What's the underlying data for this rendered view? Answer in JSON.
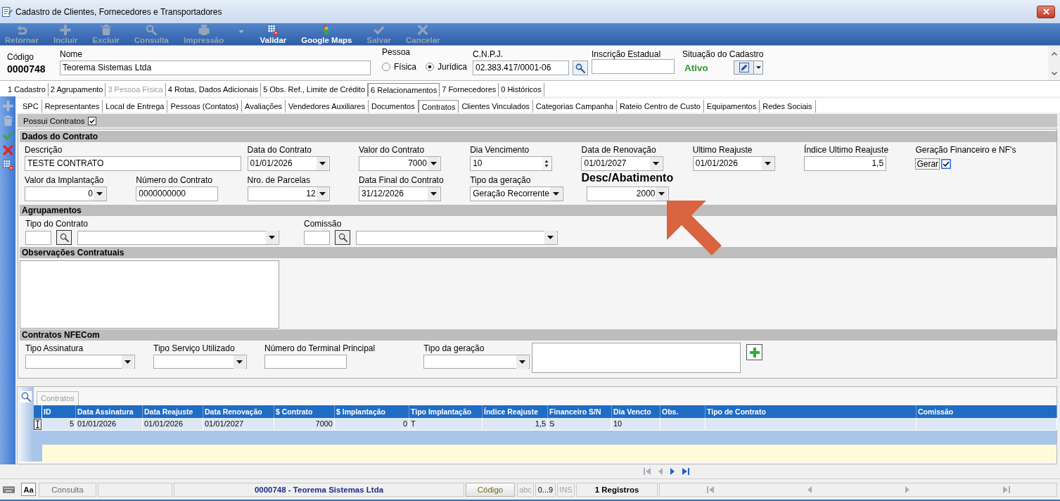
{
  "window": {
    "title": "Cadastro de Clientes, Fornecedores e Transportadores"
  },
  "toolbar": [
    {
      "label": "Retornar",
      "disabled": true,
      "menu": false
    },
    {
      "label": "Incluir",
      "disabled": true,
      "menu": false
    },
    {
      "label": "Excluir",
      "disabled": true,
      "menu": false
    },
    {
      "label": "Consulta",
      "disabled": true,
      "menu": false
    },
    {
      "label": "Impressão",
      "disabled": true,
      "menu": true
    },
    {
      "label": "Validar",
      "disabled": false,
      "menu": false
    },
    {
      "label": "Google Maps",
      "disabled": false,
      "menu": false
    },
    {
      "label": "Salvar",
      "disabled": true,
      "menu": false
    },
    {
      "label": "Cancelar",
      "disabled": true,
      "menu": false
    }
  ],
  "record": {
    "code_label": "Código",
    "code": "0000748",
    "name_label": "Nome",
    "name": "Teorema Sistemas Ltda",
    "person_label": "Pessoa",
    "person_types": [
      {
        "label": "Física",
        "selected": false
      },
      {
        "label": "Jurídica",
        "selected": true
      }
    ],
    "cnpj_label": "C.N.P.J.",
    "cnpj": "02.383.417/0001-06",
    "state_registration_label": "Inscrição Estadual",
    "status_label": "Situação do Cadastro",
    "status": "Ativo"
  },
  "tabs": [
    {
      "label": "1 Cadastro",
      "selected": false,
      "disabled": false
    },
    {
      "label": "2 Agrupamento",
      "selected": false,
      "disabled": false
    },
    {
      "label": "3 Pessoa Física",
      "selected": false,
      "disabled": true
    },
    {
      "label": "4 Rotas, Dados Adicionais",
      "selected": false,
      "disabled": false
    },
    {
      "label": "5 Obs. Ref., Limite de Crédito",
      "selected": false,
      "disabled": false
    },
    {
      "label": "6 Relacionamentos",
      "selected": true,
      "disabled": false
    },
    {
      "label": "7 Fornecedores",
      "selected": false,
      "disabled": false
    },
    {
      "label": "0 Históricos",
      "selected": false,
      "disabled": false
    }
  ],
  "side_tools": [
    {
      "disabled": true
    },
    {
      "disabled": true
    },
    {
      "disabled": false
    },
    {
      "disabled": false
    },
    {
      "disabled": false
    }
  ],
  "subtabs": [
    {
      "label": "SPC",
      "selected": false
    },
    {
      "label": "Representantes",
      "selected": false
    },
    {
      "label": "Local de Entrega",
      "selected": false
    },
    {
      "label": "Pessoas (Contatos)",
      "selected": false
    },
    {
      "label": "Avaliações",
      "selected": false
    },
    {
      "label": "Vendedores Auxiliares",
      "selected": false
    },
    {
      "label": "Documentos",
      "selected": false
    },
    {
      "label": "Contratos",
      "selected": true
    },
    {
      "label": "Clientes Vinculados",
      "selected": false
    },
    {
      "label": "Categorias Campanha",
      "selected": false
    },
    {
      "label": "Rateio Centro de Custo",
      "selected": false
    },
    {
      "label": "Equipamentos",
      "selected": false
    },
    {
      "label": "Redes Sociais",
      "selected": false
    }
  ],
  "contracts_flag": {
    "label": "Possui Contratos",
    "checked": true
  },
  "contract_data": {
    "title": "Dados do Contrato",
    "fields": [
      {
        "kind": "text",
        "label": "Descrição",
        "value": "TESTE CONTRATO",
        "emphasized": false
      },
      {
        "kind": "combo",
        "label": "Data do Contrato",
        "value": "01/01/2026",
        "emphasized": false
      },
      {
        "kind": "amount",
        "label": "Valor do Contrato",
        "value": "7000",
        "emphasized": false
      },
      {
        "kind": "spin",
        "label": "Dia Vencimento",
        "value": "10",
        "emphasized": false
      },
      {
        "kind": "combo",
        "label": "Data de Renovação",
        "value": "01/01/2027",
        "emphasized": false
      },
      {
        "kind": "combo",
        "label": "Ultimo Reajuste",
        "value": "01/01/2026",
        "emphasized": false
      },
      {
        "kind": "number",
        "label": "Índice Ultimo Reajuste",
        "value": "1,5",
        "emphasized": false
      },
      {
        "kind": "check",
        "label": "Geração Financeiro e NF's",
        "value": "Gerar",
        "checked": true,
        "emphasized": false
      },
      {
        "kind": "amount",
        "label": "Valor da Implantação",
        "value": "0",
        "emphasized": false
      },
      {
        "kind": "text",
        "label": "Número do Contrato",
        "value": "0000000000",
        "emphasized": false
      },
      {
        "kind": "amount",
        "label": "Nro. de Parcelas",
        "value": "12",
        "emphasized": false
      },
      {
        "kind": "combo",
        "label": "Data Final do Contrato",
        "value": "31/12/2026",
        "emphasized": false
      },
      {
        "kind": "combo",
        "label": "Tipo da geração",
        "value": "Geração Recorrente",
        "emphasized": false
      },
      {
        "kind": "amount",
        "label": "Desc/Abatimento",
        "value": "2000",
        "emphasized": true
      }
    ]
  },
  "grouping": {
    "title": "Agrupamentos",
    "fields": [
      {
        "label": "Tipo do Contrato"
      },
      {
        "label": "Comissão"
      }
    ]
  },
  "notes": {
    "title": "Observações Contratuais"
  },
  "nfecom": {
    "title": "Contratos NFECom",
    "fields": [
      {
        "kind": "combo",
        "label": "Tipo Assinatura"
      },
      {
        "kind": "combo",
        "label": "Tipo Serviço Utilizado"
      },
      {
        "kind": "text",
        "label": "Número do Terminal Principal"
      },
      {
        "kind": "combo",
        "label": "Tipo da geração"
      }
    ]
  },
  "grid": {
    "tab": "Contratos",
    "columns": [
      "ID",
      "Data Assinatura",
      "Data Reajuste",
      "Data Renovação",
      "$ Contrato",
      "$ Implantação",
      "Tipo Implantação",
      "Índice Reajuste",
      "Financeiro S/N",
      "Dia Vencto",
      "Obs.",
      "Tipo de Contrato",
      "Comissão"
    ],
    "rows": [
      {
        "current": true,
        "cells": [
          "5",
          "01/01/2026",
          "01/01/2026",
          "01/01/2027",
          "7000",
          "0",
          "T",
          "1,5",
          "S",
          "10"
        ]
      }
    ]
  },
  "grid_nav": [
    {
      "disabled": true
    },
    {
      "disabled": true
    },
    {
      "disabled": false
    },
    {
      "disabled": false
    }
  ],
  "status_bar": {
    "case_button": "Aa",
    "mode": "Consulta",
    "record": "0000748 - Teorema Sistemas Ltda",
    "sort_button": "Código",
    "flags": [
      {
        "label": "abc",
        "disabled": true
      },
      {
        "label": "0...9",
        "disabled": false
      },
      {
        "label": "INS",
        "disabled": true
      }
    ],
    "count": "1 Registros",
    "nav": [
      {
        "disabled": true
      },
      {
        "disabled": true
      },
      {
        "disabled": true
      },
      {
        "disabled": true
      }
    ]
  }
}
